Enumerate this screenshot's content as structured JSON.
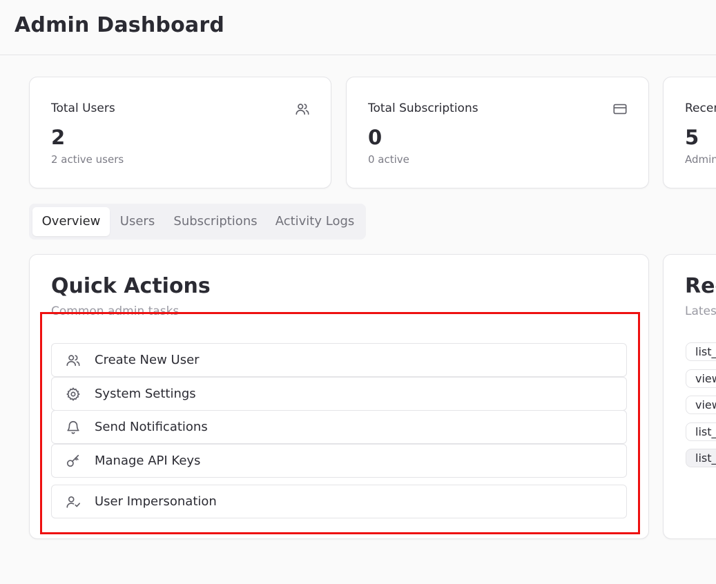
{
  "header": {
    "title": "Admin Dashboard"
  },
  "stats": [
    {
      "label": "Total Users",
      "value": "2",
      "sub": "2 active users",
      "icon": "users-icon"
    },
    {
      "label": "Total Subscriptions",
      "value": "0",
      "sub": "0 active",
      "icon": "credit-card-icon"
    },
    {
      "label": "Recen",
      "value": "5",
      "sub": "Admin",
      "icon": ""
    }
  ],
  "tabs": [
    {
      "label": "Overview",
      "active": true
    },
    {
      "label": "Users",
      "active": false
    },
    {
      "label": "Subscriptions",
      "active": false
    },
    {
      "label": "Activity Logs",
      "active": false
    }
  ],
  "quick_actions": {
    "title": "Quick Actions",
    "subtitle": "Common admin tasks",
    "items": [
      {
        "label": "Create New User",
        "icon": "users-icon"
      },
      {
        "label": "System Settings",
        "icon": "gear-icon"
      },
      {
        "label": "Send Notifications",
        "icon": "bell-icon"
      },
      {
        "label": "Manage API Keys",
        "icon": "key-icon"
      },
      {
        "label": "User Impersonation",
        "icon": "user-check-icon"
      }
    ]
  },
  "recent_activity": {
    "title": "Rec",
    "subtitle": "Lates",
    "items": [
      "list_",
      "view",
      "view",
      "list_",
      "list_"
    ]
  },
  "colors": {
    "highlight": "#ee1111",
    "background": "#fafafa"
  }
}
